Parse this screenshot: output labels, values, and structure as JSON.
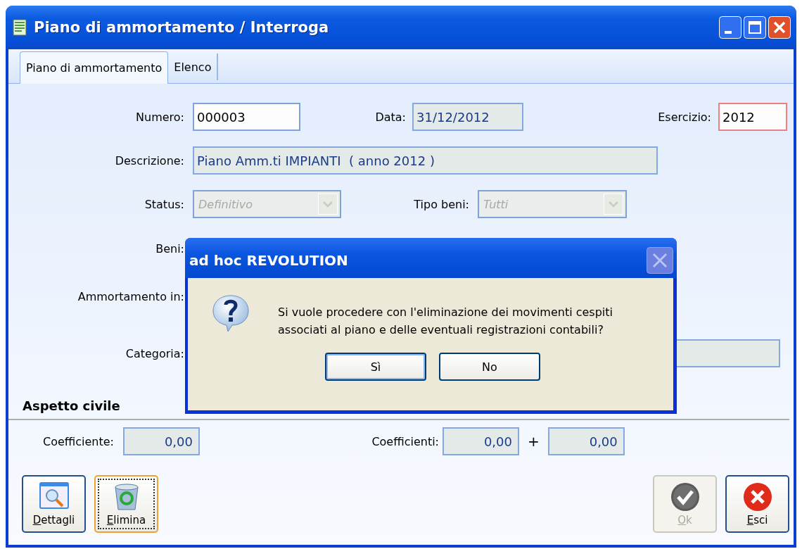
{
  "window": {
    "title": "Piano di ammortamento / Interroga"
  },
  "tabs": [
    {
      "label": "Piano di ammortamento",
      "selected": true
    },
    {
      "label": "Elenco",
      "selected": false
    }
  ],
  "form_rows": [
    {
      "items": [
        {
          "label": "Numero:",
          "kind": "text",
          "value": "000003",
          "readonly": false,
          "invalid": false
        },
        {
          "label": "Data:",
          "kind": "text",
          "value": "31/12/2012",
          "readonly": true,
          "invalid": false
        },
        {
          "label": "Esercizio:",
          "kind": "text",
          "value": "2012",
          "readonly": false,
          "invalid": true
        }
      ]
    },
    {
      "items": [
        {
          "label": "Descrizione:",
          "kind": "text",
          "value": "Piano Amm.ti IMPIANTI  ( anno 2012 )",
          "readonly": true,
          "invalid": false
        }
      ]
    },
    {
      "items": [
        {
          "label": "Status:",
          "kind": "combo",
          "value": "Definitivo",
          "disabled": true
        },
        {
          "label": "Tipo beni:",
          "kind": "combo",
          "value": "Tutti",
          "disabled": true
        }
      ]
    },
    {
      "items": [
        {
          "label": "Beni:",
          "kind": "label"
        }
      ]
    },
    {
      "items": [
        {
          "label": "Ammortamento in:",
          "kind": "label"
        }
      ]
    },
    {
      "items": [
        {
          "label": "Categoria:",
          "kind": "text",
          "readonly": true,
          "invalid": false
        }
      ]
    }
  ],
  "section": {
    "title": "Aspetto civile"
  },
  "coefficients": [
    {
      "label": "Coefficiente:",
      "values": [
        "0,00"
      ]
    },
    {
      "label": "Coefficienti:",
      "values": [
        "0,00",
        "0,00"
      ],
      "joiner": "+"
    }
  ],
  "buttons_left": [
    {
      "label": "Dettagli",
      "kind": "details",
      "focused": false,
      "disabled": false
    },
    {
      "label": "Elimina",
      "kind": "delete",
      "focused": true,
      "disabled": false
    }
  ],
  "buttons_right": [
    {
      "label": "Ok",
      "kind": "confirm",
      "focused": false,
      "disabled": true
    },
    {
      "label": "Esci",
      "kind": "exit",
      "focused": false,
      "disabled": false
    }
  ],
  "dialog": {
    "title": "ad hoc REVOLUTION",
    "message_lines": [
      "Si vuole procedere con l'eliminazione dei movimenti cespiti",
      "associati al piano e delle eventuali registrazioni contabili?"
    ],
    "buttons": [
      {
        "label": "Sì",
        "default": true
      },
      {
        "label": "No",
        "default": false
      }
    ]
  }
}
